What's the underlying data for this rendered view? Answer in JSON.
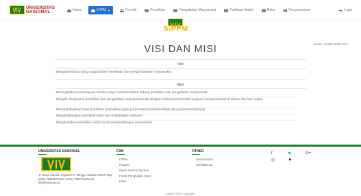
{
  "brand": {
    "line1": "UNIVERSITAS",
    "line2": "NASIONAL"
  },
  "nav": {
    "items": [
      {
        "label": "Home",
        "icon": "home-icon"
      },
      {
        "label": "LPPM",
        "icon": "building-icon",
        "active": true
      },
      {
        "label": "Peneliti",
        "icon": "users-icon"
      },
      {
        "label": "Penelitian",
        "icon": "flask-icon"
      },
      {
        "label": "Pengabdian Masyarakat",
        "icon": "handshake-icon"
      },
      {
        "label": "Publikasi Ilmiah",
        "icon": "book-icon"
      },
      {
        "label": "Buku",
        "icon": "book-open-icon"
      },
      {
        "label": "Pengumuman",
        "icon": "megaphone-icon"
      }
    ],
    "login": "Login"
  },
  "hero": {
    "wordmark": "SiPPM"
  },
  "date": "Kamis, 28 Mei 2020 06:0",
  "page": {
    "title": "VISI DAN MISI",
    "visi_heading": "Visi",
    "visi_text": "Menjadi institusi yang unggul dalam penelitian dan pengembangan masyarakat.",
    "misi_heading": "Misi",
    "misi_items": [
      "Meningkatkan kemampuan sumber daya manusia dalam bidang penelitian dan pengabdian masyarakat.",
      "Menjalin kerjasama penelitian dan pengabdian masyarakat baik dengan institusi pemerintah maupun non pemerintah di dalam dan luar negeri.",
      "Mempublikasikan hasil penelitian berkualitas pada jurnal nasional terakreditasi dan jurnal internasional.",
      "Mengembangkan penelitian inter dan multidisiplin keilmuan.",
      "Menghasilkan penelitian untuk model pengembangan masyarakat."
    ]
  },
  "footer": {
    "col1_title": "UNIVERSITAS NASIONAL",
    "address": "Jl. Sawo Manila, Pejaten Ps. Minggu Jakarta 12520 Telp: (021) 7806700 Faks: (021) 7802718 Email: info@unas.ac.id",
    "col2_title": "P2M",
    "col2_items": [
      "LPPM",
      "Prajuris",
      "Open Journal System",
      "Pusat Pengkajian Islam",
      "Fasil"
    ],
    "col3_title": "OTHER",
    "col3_items": [
      "Kemenristek",
      "Simlitabmas"
    ],
    "social": [
      {
        "icon": "facebook-icon",
        "glyph": "f"
      },
      {
        "icon": "twitter-icon",
        "glyph": "🐦"
      },
      {
        "icon": "google-plus-icon",
        "glyph": "G+"
      },
      {
        "icon": "instagram-icon",
        "glyph": "◎"
      },
      {
        "icon": "youtube-icon",
        "glyph": "▶"
      }
    ],
    "copyright": "Unas © 2020 Copyright"
  },
  "colors": {
    "brand_green": "#1a7a2a",
    "brand_gold": "#f2c200",
    "brand_red": "#b41e1e",
    "nav_active": "#1f6fcf"
  }
}
